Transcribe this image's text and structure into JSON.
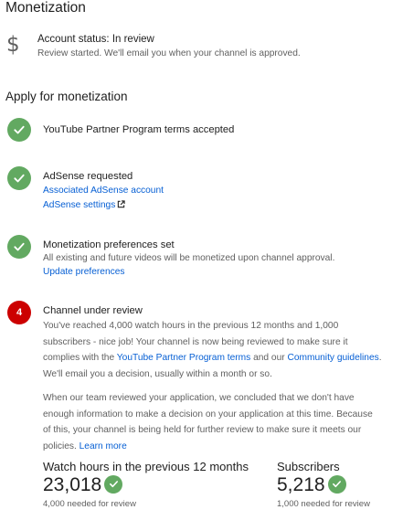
{
  "header": {
    "title": "Monetization"
  },
  "account": {
    "icon": "dollar-icon",
    "status": "Account status: In review",
    "detail": "Review started. We'll email you when your channel is approved."
  },
  "apply": {
    "title": "Apply for monetization"
  },
  "steps": [
    {
      "title": "YouTube Partner Program terms accepted",
      "state": "done"
    },
    {
      "title": "AdSense requested",
      "state": "done",
      "links": [
        "Associated AdSense account",
        "AdSense settings"
      ]
    },
    {
      "title": "Monetization preferences set",
      "state": "done",
      "detail": "All existing and future videos will be monetized upon channel approval.",
      "links": [
        "Update preferences"
      ]
    },
    {
      "title": "Channel under review",
      "state": "current",
      "number": "4",
      "para1": {
        "line1": "You've reached 4,000 watch hours in the previous 12 months and 1,000",
        "line2": "subscribers - nice job! Your channel is now being reviewed to make sure it",
        "line3_pre": "complies with the ",
        "link_terms": "YouTube Partner Program terms",
        "line3_mid": " and our ",
        "link_guidelines": "Community guidelines",
        "line3_end": ".",
        "line4": "We'll email you a decision, usually within a month or so."
      },
      "para2": {
        "line1": "When our team reviewed your application, we concluded that we don't have",
        "line2": "enough information to make a decision on your application at this time. Because",
        "line3": "of this, your channel is being held for further review to make sure it meets our",
        "line4_pre": "policies. ",
        "link_learn": "Learn more"
      }
    }
  ],
  "stats": {
    "watch": {
      "label": "Watch hours in the previous 12 months",
      "value": "23,018",
      "needed": "4,000 needed for review"
    },
    "subs": {
      "label": "Subscribers",
      "value": "5,218",
      "needed": "1,000 needed for review"
    }
  },
  "colors": {
    "green": "#62a961",
    "red": "#cc0000",
    "link": "#065fd4",
    "muted": "#606060"
  }
}
